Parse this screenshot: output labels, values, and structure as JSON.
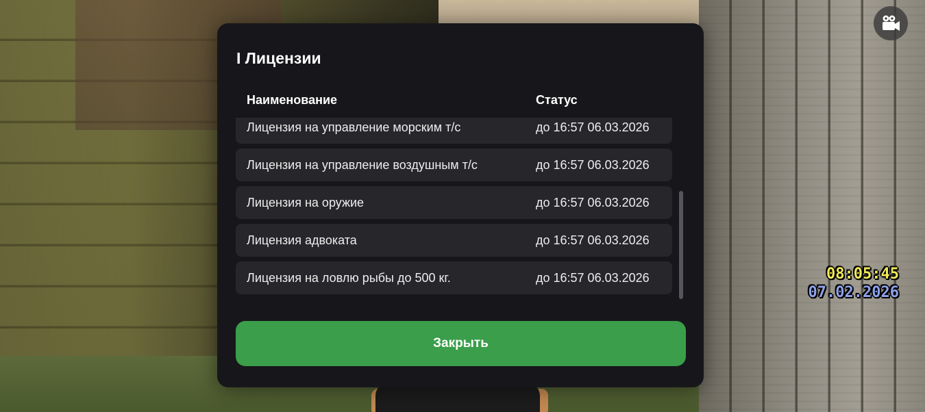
{
  "dialog": {
    "title": "I Лицензии",
    "columns": {
      "name": "Наименование",
      "status": "Статус"
    },
    "rows": [
      {
        "name": "Лицензия на управление морским т/с",
        "status": "до 16:57 06.03.2026"
      },
      {
        "name": "Лицензия на управление воздушным т/с",
        "status": "до 16:57 06.03.2026"
      },
      {
        "name": "Лицензия на оружие",
        "status": "до 16:57 06.03.2026"
      },
      {
        "name": "Лицензия адвоката",
        "status": "до 16:57 06.03.2026"
      },
      {
        "name": "Лицензия на ловлю рыбы до 500 кг.",
        "status": "до 16:57 06.03.2026"
      }
    ],
    "close_label": "Закрыть"
  },
  "hud": {
    "time": "08:05:45",
    "date": "07.02.2026",
    "camera_icon": "video-camera-icon"
  },
  "colors": {
    "accent_green": "#3a9e4a",
    "modal_bg": "#17171b",
    "row_bg": "#26262b",
    "clock_time": "#f0ea5a",
    "clock_date": "#8fa2ea"
  }
}
